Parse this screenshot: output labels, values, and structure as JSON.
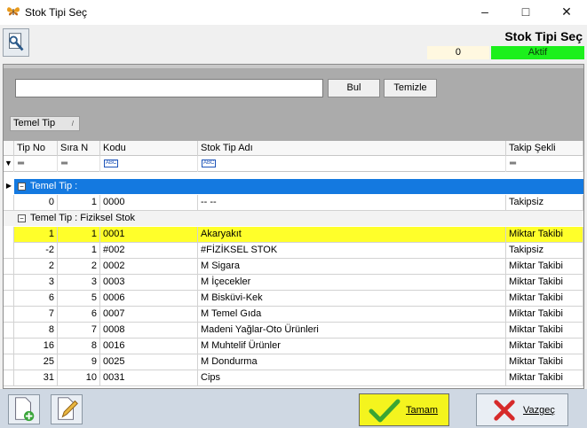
{
  "window": {
    "title": "Stok Tipi Seç"
  },
  "header": {
    "title": "Stok Tipi Seç",
    "counter": "0",
    "status": "Aktif"
  },
  "search": {
    "value": "",
    "find_label": "Bul",
    "clear_label": "Temizle"
  },
  "grouping": {
    "chip_label": "Temel Tip",
    "sort_glyph": "/"
  },
  "columns": [
    "Tip No",
    "Sıra N",
    "Kodu",
    "Stok Tip Adı",
    "Takip Şekli"
  ],
  "groups": [
    {
      "label": "Temel Tip :"
    },
    {
      "label": "Temel Tip : Fiziksel Stok"
    }
  ],
  "rows": [
    {
      "tip_no": "0",
      "sira": "1",
      "kodu": "0000",
      "adi": "-- --",
      "takip": "Takipsiz"
    },
    {
      "tip_no": "1",
      "sira": "1",
      "kodu": "0001",
      "adi": "Akaryakıt",
      "takip": "Miktar Takibi"
    },
    {
      "tip_no": "-2",
      "sira": "1",
      "kodu": "#002",
      "adi": "#FİZİKSEL STOK",
      "takip": "Takipsiz"
    },
    {
      "tip_no": "2",
      "sira": "2",
      "kodu": "0002",
      "adi": "M Sigara",
      "takip": "Miktar Takibi"
    },
    {
      "tip_no": "3",
      "sira": "3",
      "kodu": "0003",
      "adi": "M İçecekler",
      "takip": "Miktar Takibi"
    },
    {
      "tip_no": "6",
      "sira": "5",
      "kodu": "0006",
      "adi": "M Bisküvi-Kek",
      "takip": "Miktar Takibi"
    },
    {
      "tip_no": "7",
      "sira": "6",
      "kodu": "0007",
      "adi": "M Temel Gıda",
      "takip": "Miktar Takibi"
    },
    {
      "tip_no": "8",
      "sira": "7",
      "kodu": "0008",
      "adi": "Madeni Yağlar-Oto Ürünleri",
      "takip": "Miktar Takibi"
    },
    {
      "tip_no": "16",
      "sira": "8",
      "kodu": "0016",
      "adi": "M Muhtelif Ürünler",
      "takip": "Miktar Takibi"
    },
    {
      "tip_no": "25",
      "sira": "9",
      "kodu": "0025",
      "adi": "M Dondurma",
      "takip": "Miktar Takibi"
    },
    {
      "tip_no": "31",
      "sira": "10",
      "kodu": "0031",
      "adi": "Cips",
      "takip": "Miktar Takibi"
    }
  ],
  "footer": {
    "ok_label": "Tamam",
    "cancel_label": "Vazgeç"
  },
  "colors": {
    "selected_group": "#1479e0",
    "highlight_row": "#ffff2a",
    "status": "#1cf01c"
  }
}
